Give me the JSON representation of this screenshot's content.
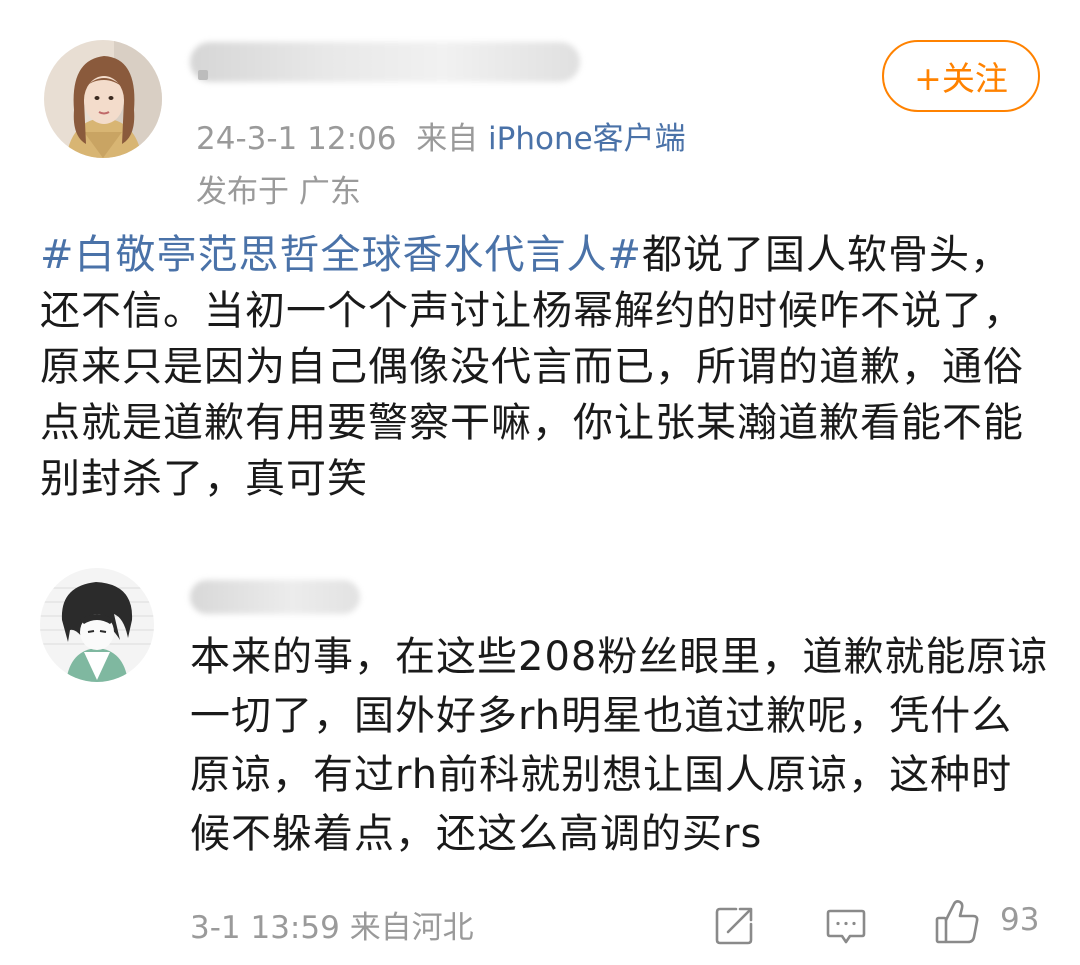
{
  "post": {
    "follow_label": "+关注",
    "timestamp": "24-3-1 12:06",
    "source_prefix": "来自",
    "source_client": "iPhone客户端",
    "location": "发布于 广东",
    "hashtag": "#白敬亭范思哲全球香水代言人#",
    "text": "都说了国人软骨头，还不信。当初一个个声讨让杨幂解约的时候咋不说了，原来只是因为自己偶像没代言而已，所谓的道歉，通俗点就是道歉有用要警察干嘛，你让张某瀚道歉看能不能别封杀了，真可笑"
  },
  "reply": {
    "text": "本来的事，在这些208粉丝眼里，道歉就能原谅一切了，国外好多rh明星也道过歉呢，凭什么原谅，有过rh前科就别想让国人原谅，这种时候不躲着点，还这么高调的买rs",
    "timestamp": "3-1 13:59",
    "location": "来自河北",
    "like_count": "93"
  },
  "icons": {
    "share": "share-icon",
    "comment": "comment-icon",
    "like": "thumbs-up-icon"
  },
  "colors": {
    "accent": "#ff8200",
    "link": "#4a72a8",
    "meta": "#9a9a9a"
  }
}
